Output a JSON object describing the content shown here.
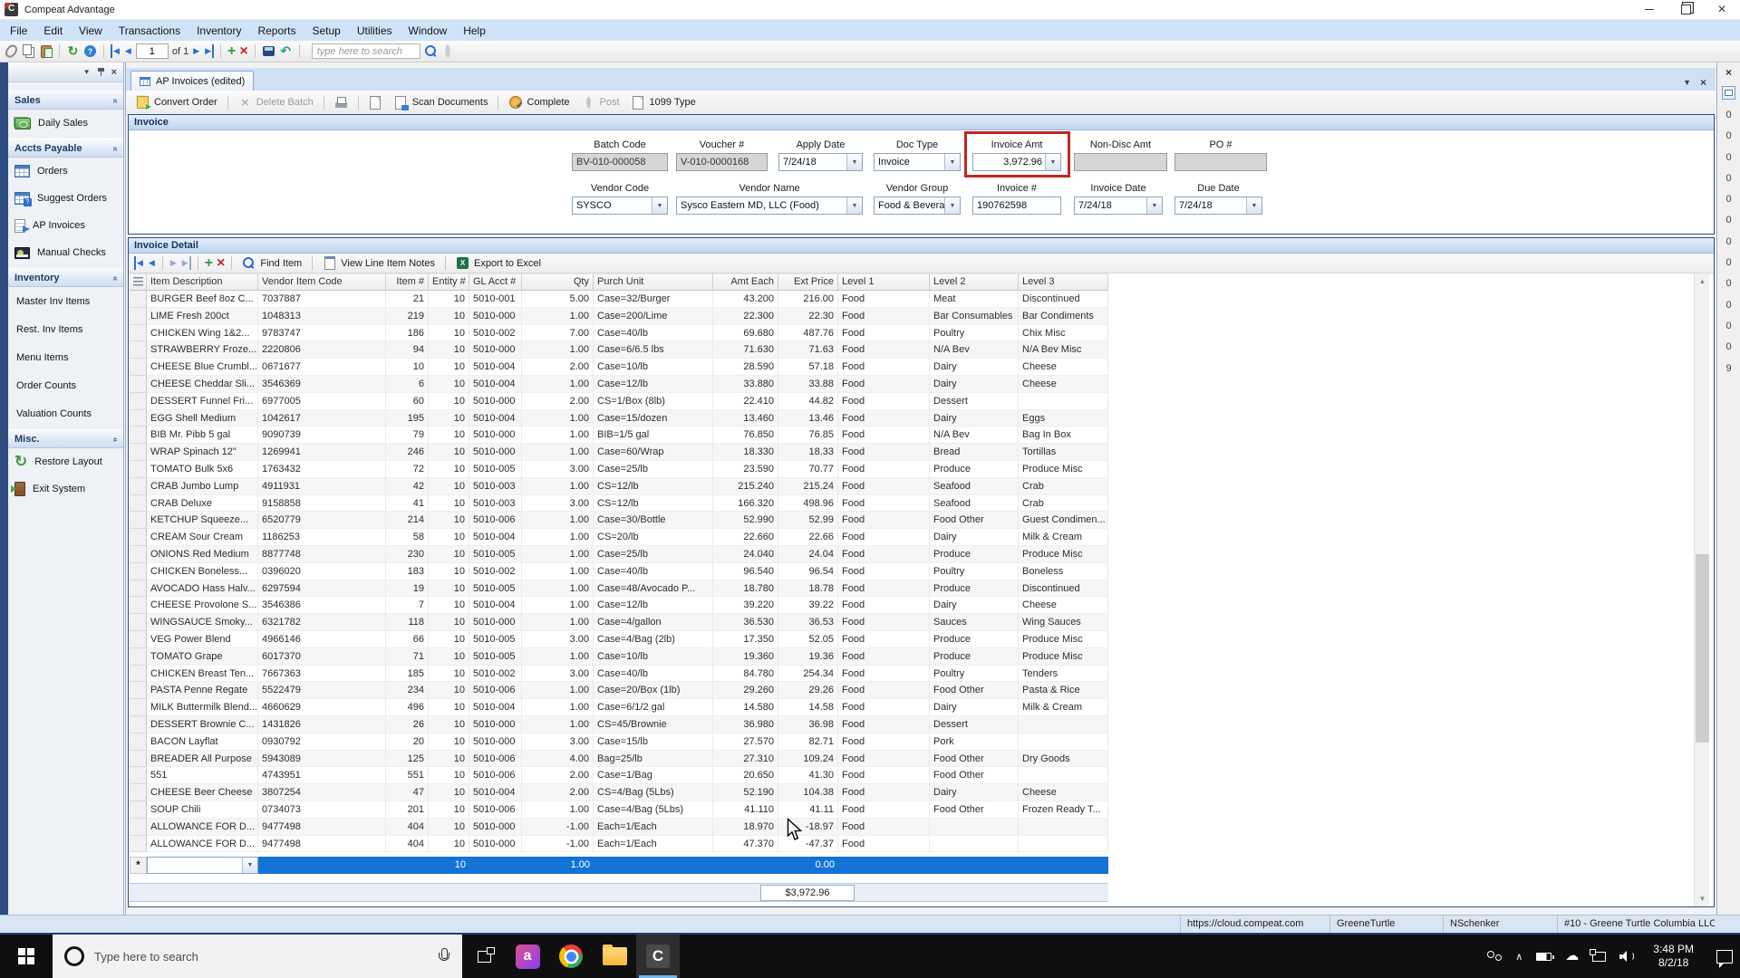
{
  "window": {
    "title": "Compeat Advantage"
  },
  "menu_bar": [
    "File",
    "Edit",
    "View",
    "Transactions",
    "Inventory",
    "Reports",
    "Setup",
    "Utilities",
    "Window",
    "Help"
  ],
  "top_toolbar": {
    "icons_left": [
      "clip",
      "copy",
      "paste",
      "refresh",
      "help"
    ],
    "record_value": "1",
    "record_of_label": "of 1",
    "search_placeholder": "type here to search"
  },
  "sidebar": {
    "sections": [
      {
        "label": "Sales",
        "items": [
          {
            "label": "Daily Sales",
            "icon": "money"
          }
        ]
      },
      {
        "label": "Accts Payable",
        "items": [
          {
            "label": "Orders",
            "icon": "grid"
          },
          {
            "label": "Suggest Orders",
            "icon": "gridq"
          },
          {
            "label": "AP Invoices",
            "icon": "invoice"
          },
          {
            "label": "Manual Checks",
            "icon": "check"
          }
        ]
      },
      {
        "label": "Inventory",
        "items": [
          {
            "label": "Master Inv Items"
          },
          {
            "label": "Rest. Inv Items"
          },
          {
            "label": "Menu Items"
          },
          {
            "label": "Order Counts"
          },
          {
            "label": "Valuation Counts"
          }
        ]
      },
      {
        "label": "Misc.",
        "items": [
          {
            "label": "Restore Layout",
            "icon": "restore"
          },
          {
            "label": "Exit System",
            "icon": "door"
          }
        ]
      }
    ]
  },
  "tab": {
    "label": "AP Invoices (edited)"
  },
  "doc_toolbar": [
    {
      "label": "Convert Order",
      "icon": "convert",
      "enabled": true,
      "sep_before": false
    },
    {
      "label": "Delete Batch",
      "icon": "delx",
      "enabled": false,
      "sep_before": true
    },
    {
      "label": "",
      "icon": "printer",
      "enabled": true,
      "sep_before": true
    },
    {
      "label": "",
      "icon": "page",
      "enabled": true,
      "sep_before": true
    },
    {
      "label": "Scan Documents",
      "icon": "scan",
      "enabled": true,
      "sep_before": false
    },
    {
      "label": "Complete",
      "icon": "complete",
      "enabled": true,
      "sep_before": true
    },
    {
      "label": "Post",
      "icon": "feather",
      "enabled": false,
      "sep_before": false
    },
    {
      "label": "1099 Type",
      "icon": "page",
      "enabled": true,
      "sep_before": false
    }
  ],
  "invoice_panel": {
    "title": "Invoice",
    "header_fields": [
      {
        "label": "Batch Code",
        "value": "BV-010-000058",
        "type": "readonly"
      },
      {
        "label": "Voucher #",
        "value": "V-010-0000168",
        "type": "readonly"
      },
      {
        "label": "Apply Date",
        "value": "7/24/18",
        "type": "combo"
      },
      {
        "label": "Doc Type",
        "value": "Invoice",
        "type": "combo"
      },
      {
        "label": "Invoice Amt",
        "value": "3,972.96",
        "type": "combo",
        "align": "right",
        "highlighted": true
      },
      {
        "label": "Non-Disc Amt",
        "value": "",
        "type": "readonly"
      },
      {
        "label": "PO #",
        "value": "",
        "type": "readonly"
      }
    ],
    "vendor_fields": [
      {
        "label": "Vendor Code",
        "value": "SYSCO",
        "type": "combo"
      },
      {
        "label": "Vendor Name",
        "value": "Sysco Eastern MD, LLC (Food)",
        "type": "combo"
      },
      {
        "label": "Vendor Group",
        "value": "Food & Beverag",
        "type": "combo"
      },
      {
        "label": "Invoice #",
        "value": "190762598",
        "type": "text"
      },
      {
        "label": "Invoice Date",
        "value": "7/24/18",
        "type": "combo"
      },
      {
        "label": "Due Date",
        "value": "7/24/18",
        "type": "combo"
      }
    ]
  },
  "detail_panel": {
    "title": "Invoice Detail",
    "toolbar": {
      "find_item": "Find Item",
      "view_notes": "View Line Item Notes",
      "export": "Export to Excel"
    },
    "grid": {
      "columns": [
        "Item Description",
        "Vendor Item Code",
        "Item #",
        "Entity #",
        "GL Acct #",
        "Qty",
        "Purch Unit",
        "Amt Each",
        "Ext Price",
        "Level 1",
        "Level 2",
        "Level 3"
      ],
      "rows": [
        [
          "BURGER Beef 8oz C...",
          "7037887",
          "21",
          "10",
          "5010-001",
          "5.00",
          "Case=32/Burger",
          "43.200",
          "216.00",
          "Food",
          "Meat",
          "Discontinued"
        ],
        [
          "LIME Fresh 200ct",
          "1048313",
          "219",
          "10",
          "5010-000",
          "1.00",
          "Case=200/Lime",
          "22.300",
          "22.30",
          "Food",
          "Bar Consumables",
          "Bar Condiments"
        ],
        [
          "CHICKEN Wing 1&2...",
          "9783747",
          "186",
          "10",
          "5010-002",
          "7.00",
          "Case=40/lb",
          "69.680",
          "487.76",
          "Food",
          "Poultry",
          "Chix Misc"
        ],
        [
          "STRAWBERRY Froze...",
          "2220806",
          "94",
          "10",
          "5010-000",
          "1.00",
          "Case=6/6.5 lbs",
          "71.630",
          "71.63",
          "Food",
          "N/A Bev",
          "N/A Bev Misc"
        ],
        [
          "CHEESE Blue Crumbl...",
          "0671677",
          "10",
          "10",
          "5010-004",
          "2.00",
          "Case=10/lb",
          "28.590",
          "57.18",
          "Food",
          "Dairy",
          "Cheese"
        ],
        [
          "CHEESE Cheddar Sli...",
          "3546369",
          "6",
          "10",
          "5010-004",
          "1.00",
          "Case=12/lb",
          "33.880",
          "33.88",
          "Food",
          "Dairy",
          "Cheese"
        ],
        [
          "DESSERT Funnel Fri...",
          "6977005",
          "60",
          "10",
          "5010-000",
          "2.00",
          "CS=1/Box (8lb)",
          "22.410",
          "44.82",
          "Food",
          "Dessert",
          ""
        ],
        [
          "EGG Shell Medium",
          "1042617",
          "195",
          "10",
          "5010-004",
          "1.00",
          "Case=15/dozen",
          "13.460",
          "13.46",
          "Food",
          "Dairy",
          "Eggs"
        ],
        [
          "BIB Mr. Pibb 5 gal",
          "9090739",
          "79",
          "10",
          "5010-000",
          "1.00",
          "BIB=1/5 gal",
          "76.850",
          "76.85",
          "Food",
          "N/A Bev",
          "Bag In Box"
        ],
        [
          "WRAP Spinach 12\"",
          "1269941",
          "246",
          "10",
          "5010-000",
          "1.00",
          "Case=60/Wrap",
          "18.330",
          "18.33",
          "Food",
          "Bread",
          "Tortillas"
        ],
        [
          "TOMATO Bulk 5x6",
          "1763432",
          "72",
          "10",
          "5010-005",
          "3.00",
          "Case=25/lb",
          "23.590",
          "70.77",
          "Food",
          "Produce",
          "Produce Misc"
        ],
        [
          "CRAB Jumbo Lump",
          "4911931",
          "42",
          "10",
          "5010-003",
          "1.00",
          "CS=12/lb",
          "215.240",
          "215.24",
          "Food",
          "Seafood",
          "Crab"
        ],
        [
          "CRAB Deluxe",
          "9158858",
          "41",
          "10",
          "5010-003",
          "3.00",
          "CS=12/lb",
          "166.320",
          "498.96",
          "Food",
          "Seafood",
          "Crab"
        ],
        [
          "KETCHUP Squeeze...",
          "6520779",
          "214",
          "10",
          "5010-006",
          "1.00",
          "Case=30/Bottle",
          "52.990",
          "52.99",
          "Food",
          "Food Other",
          "Guest Condimen..."
        ],
        [
          "CREAM Sour Cream",
          "1186253",
          "58",
          "10",
          "5010-004",
          "1.00",
          "CS=20/lb",
          "22.660",
          "22.66",
          "Food",
          "Dairy",
          "Milk & Cream"
        ],
        [
          "ONIONS Red Medium",
          "8877748",
          "230",
          "10",
          "5010-005",
          "1.00",
          "Case=25/lb",
          "24.040",
          "24.04",
          "Food",
          "Produce",
          "Produce Misc"
        ],
        [
          "CHICKEN Boneless...",
          "0396020",
          "183",
          "10",
          "5010-002",
          "1.00",
          "Case=40/lb",
          "96.540",
          "96.54",
          "Food",
          "Poultry",
          "Boneless"
        ],
        [
          "AVOCADO Hass Halv...",
          "6297594",
          "19",
          "10",
          "5010-005",
          "1.00",
          "Case=48/Avocado P...",
          "18.780",
          "18.78",
          "Food",
          "Produce",
          "Discontinued"
        ],
        [
          "CHEESE Provolone S...",
          "3546386",
          "7",
          "10",
          "5010-004",
          "1.00",
          "Case=12/lb",
          "39.220",
          "39.22",
          "Food",
          "Dairy",
          "Cheese"
        ],
        [
          "WINGSAUCE Smoky...",
          "6321782",
          "118",
          "10",
          "5010-000",
          "1.00",
          "Case=4/gallon",
          "36.530",
          "36.53",
          "Food",
          "Sauces",
          "Wing Sauces"
        ],
        [
          "VEG Power Blend",
          "4966146",
          "66",
          "10",
          "5010-005",
          "3.00",
          "Case=4/Bag (2lb)",
          "17.350",
          "52.05",
          "Food",
          "Produce",
          "Produce Misc"
        ],
        [
          "TOMATO Grape",
          "6017370",
          "71",
          "10",
          "5010-005",
          "1.00",
          "Case=10/lb",
          "19.360",
          "19.36",
          "Food",
          "Produce",
          "Produce Misc"
        ],
        [
          "CHICKEN Breast Ten...",
          "7667363",
          "185",
          "10",
          "5010-002",
          "3.00",
          "Case=40/lb",
          "84.780",
          "254.34",
          "Food",
          "Poultry",
          "Tenders"
        ],
        [
          "PASTA Penne Regate",
          "5522479",
          "234",
          "10",
          "5010-006",
          "1.00",
          "Case=20/Box (1lb)",
          "29.260",
          "29.26",
          "Food",
          "Food Other",
          "Pasta & Rice"
        ],
        [
          "MILK Buttermilk Blend...",
          "4660629",
          "496",
          "10",
          "5010-004",
          "1.00",
          "Case=6/1/2 gal",
          "14.580",
          "14.58",
          "Food",
          "Dairy",
          "Milk & Cream"
        ],
        [
          "DESSERT Brownie C...",
          "1431826",
          "26",
          "10",
          "5010-000",
          "1.00",
          "CS=45/Brownie",
          "36.980",
          "36.98",
          "Food",
          "Dessert",
          ""
        ],
        [
          "BACON Layflat",
          "0930792",
          "20",
          "10",
          "5010-000",
          "3.00",
          "Case=15/lb",
          "27.570",
          "82.71",
          "Food",
          "Pork",
          ""
        ],
        [
          "BREADER All Purpose",
          "5943089",
          "125",
          "10",
          "5010-006",
          "4.00",
          "Bag=25/lb",
          "27.310",
          "109.24",
          "Food",
          "Food Other",
          "Dry Goods"
        ],
        [
          "551",
          "4743951",
          "551",
          "10",
          "5010-006",
          "2.00",
          "Case=1/Bag",
          "20.650",
          "41.30",
          "Food",
          "Food Other",
          ""
        ],
        [
          "CHEESE Beer Cheese",
          "3807254",
          "47",
          "10",
          "5010-004",
          "2.00",
          "CS=4/Bag (5Lbs)",
          "52.190",
          "104.38",
          "Food",
          "Dairy",
          "Cheese"
        ],
        [
          "SOUP Chili",
          "0734073",
          "201",
          "10",
          "5010-006",
          "1.00",
          "Case=4/Bag (5Lbs)",
          "41.110",
          "41.11",
          "Food",
          "Food Other",
          "Frozen Ready T..."
        ],
        [
          "ALLOWANCE FOR D...",
          "9477498",
          "404",
          "10",
          "5010-000",
          "-1.00",
          "Each=1/Each",
          "18.970",
          "-18.97",
          "Food",
          "",
          ""
        ],
        [
          "ALLOWANCE FOR D...",
          "9477498",
          "404",
          "10",
          "5010-000",
          "-1.00",
          "Each=1/Each",
          "47.370",
          "-47.37",
          "Food",
          "",
          ""
        ]
      ],
      "new_row": {
        "entity": "10",
        "qty": "1.00",
        "ext_price": "0.00"
      },
      "total": "$3,972.96"
    }
  },
  "right_strip": {
    "digits": [
      "0",
      "0",
      "0",
      "0",
      "0",
      "0",
      "0",
      "0",
      "0",
      "0",
      "0",
      "0",
      "9"
    ]
  },
  "status_bar": {
    "segments": [
      "https://cloud.compeat.com",
      "GreeneTurtle",
      "NSchenker",
      "#10 - Greene Turtle Columbia LLC"
    ]
  },
  "taskbar": {
    "search_placeholder": "Type here to search",
    "time": "3:48 PM",
    "date": "8/2/18"
  },
  "colors": {
    "highlight_red": "#c1281e",
    "new_row_blue": "#1374d6",
    "menu_blue": "#cfe3f8"
  }
}
